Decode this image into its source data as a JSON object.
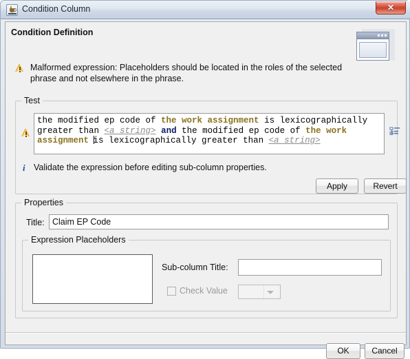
{
  "window": {
    "title": "Condition Column",
    "app_icon": "java-coffee-cup-icon",
    "close_label": "✕"
  },
  "header": {
    "title": "Condition Definition",
    "decoration_icon": "window-dialog-icon",
    "message": {
      "icon": "warning-triangle-icon",
      "text": "Malformed expression: Placeholders should be located in the roles of the selected phrase and not elsewhere in the phrase."
    }
  },
  "test_group": {
    "legend": "Test",
    "status_icon": "warning-triangle-icon",
    "tree_icon": "tree-hierarchy-icon",
    "expression": {
      "tokens": [
        {
          "text": "the modified ep code of ",
          "style": "plain"
        },
        {
          "text": "the work assignment",
          "style": "role"
        },
        {
          "text": " is lexicographically greater than ",
          "style": "plain"
        },
        {
          "text": "<a string>",
          "style": "placeholder"
        },
        {
          "text": " ",
          "style": "plain"
        },
        {
          "text": "and",
          "style": "keyword"
        },
        {
          "text": " the modified ep code of ",
          "style": "plain"
        },
        {
          "text": "the work assignment",
          "style": "role"
        },
        {
          "text": " ",
          "style": "caret"
        },
        {
          "text": "is lexicographically greater than ",
          "style": "plain"
        },
        {
          "text": "<a string>",
          "style": "placeholder"
        }
      ],
      "plain_text": "the modified ep code of the work assignment is lexicographically greater than <a string> and the modified ep code of the work assignment is lexicographically greater than <a string>"
    },
    "hint": {
      "icon": "info-icon",
      "glyph": "i",
      "text": "Validate the expression before editing sub-column properties."
    },
    "apply_label": "Apply",
    "revert_label": "Revert"
  },
  "properties_group": {
    "legend": "Properties",
    "title_label": "Title:",
    "title_value": "Claim EP Code",
    "title_placeholder": ""
  },
  "placeholders_group": {
    "legend": "Expression Placeholders",
    "list_items": [],
    "subcolumn_label": "Sub-column Title:",
    "subcolumn_value": "",
    "subcolumn_placeholder": "",
    "check_value_label": "Check Value",
    "check_value_checked": false,
    "check_value_enabled": false,
    "check_combo_selected": "",
    "check_combo_options": []
  },
  "footer": {
    "ok_label": "OK",
    "cancel_label": "Cancel"
  },
  "colors": {
    "keyword": "#0d1b63",
    "role": "#8a7220",
    "placeholder": "#8c8c8c",
    "warning": "#e8b33a",
    "info": "#1b4f9c",
    "close_button": "#c8412d"
  }
}
